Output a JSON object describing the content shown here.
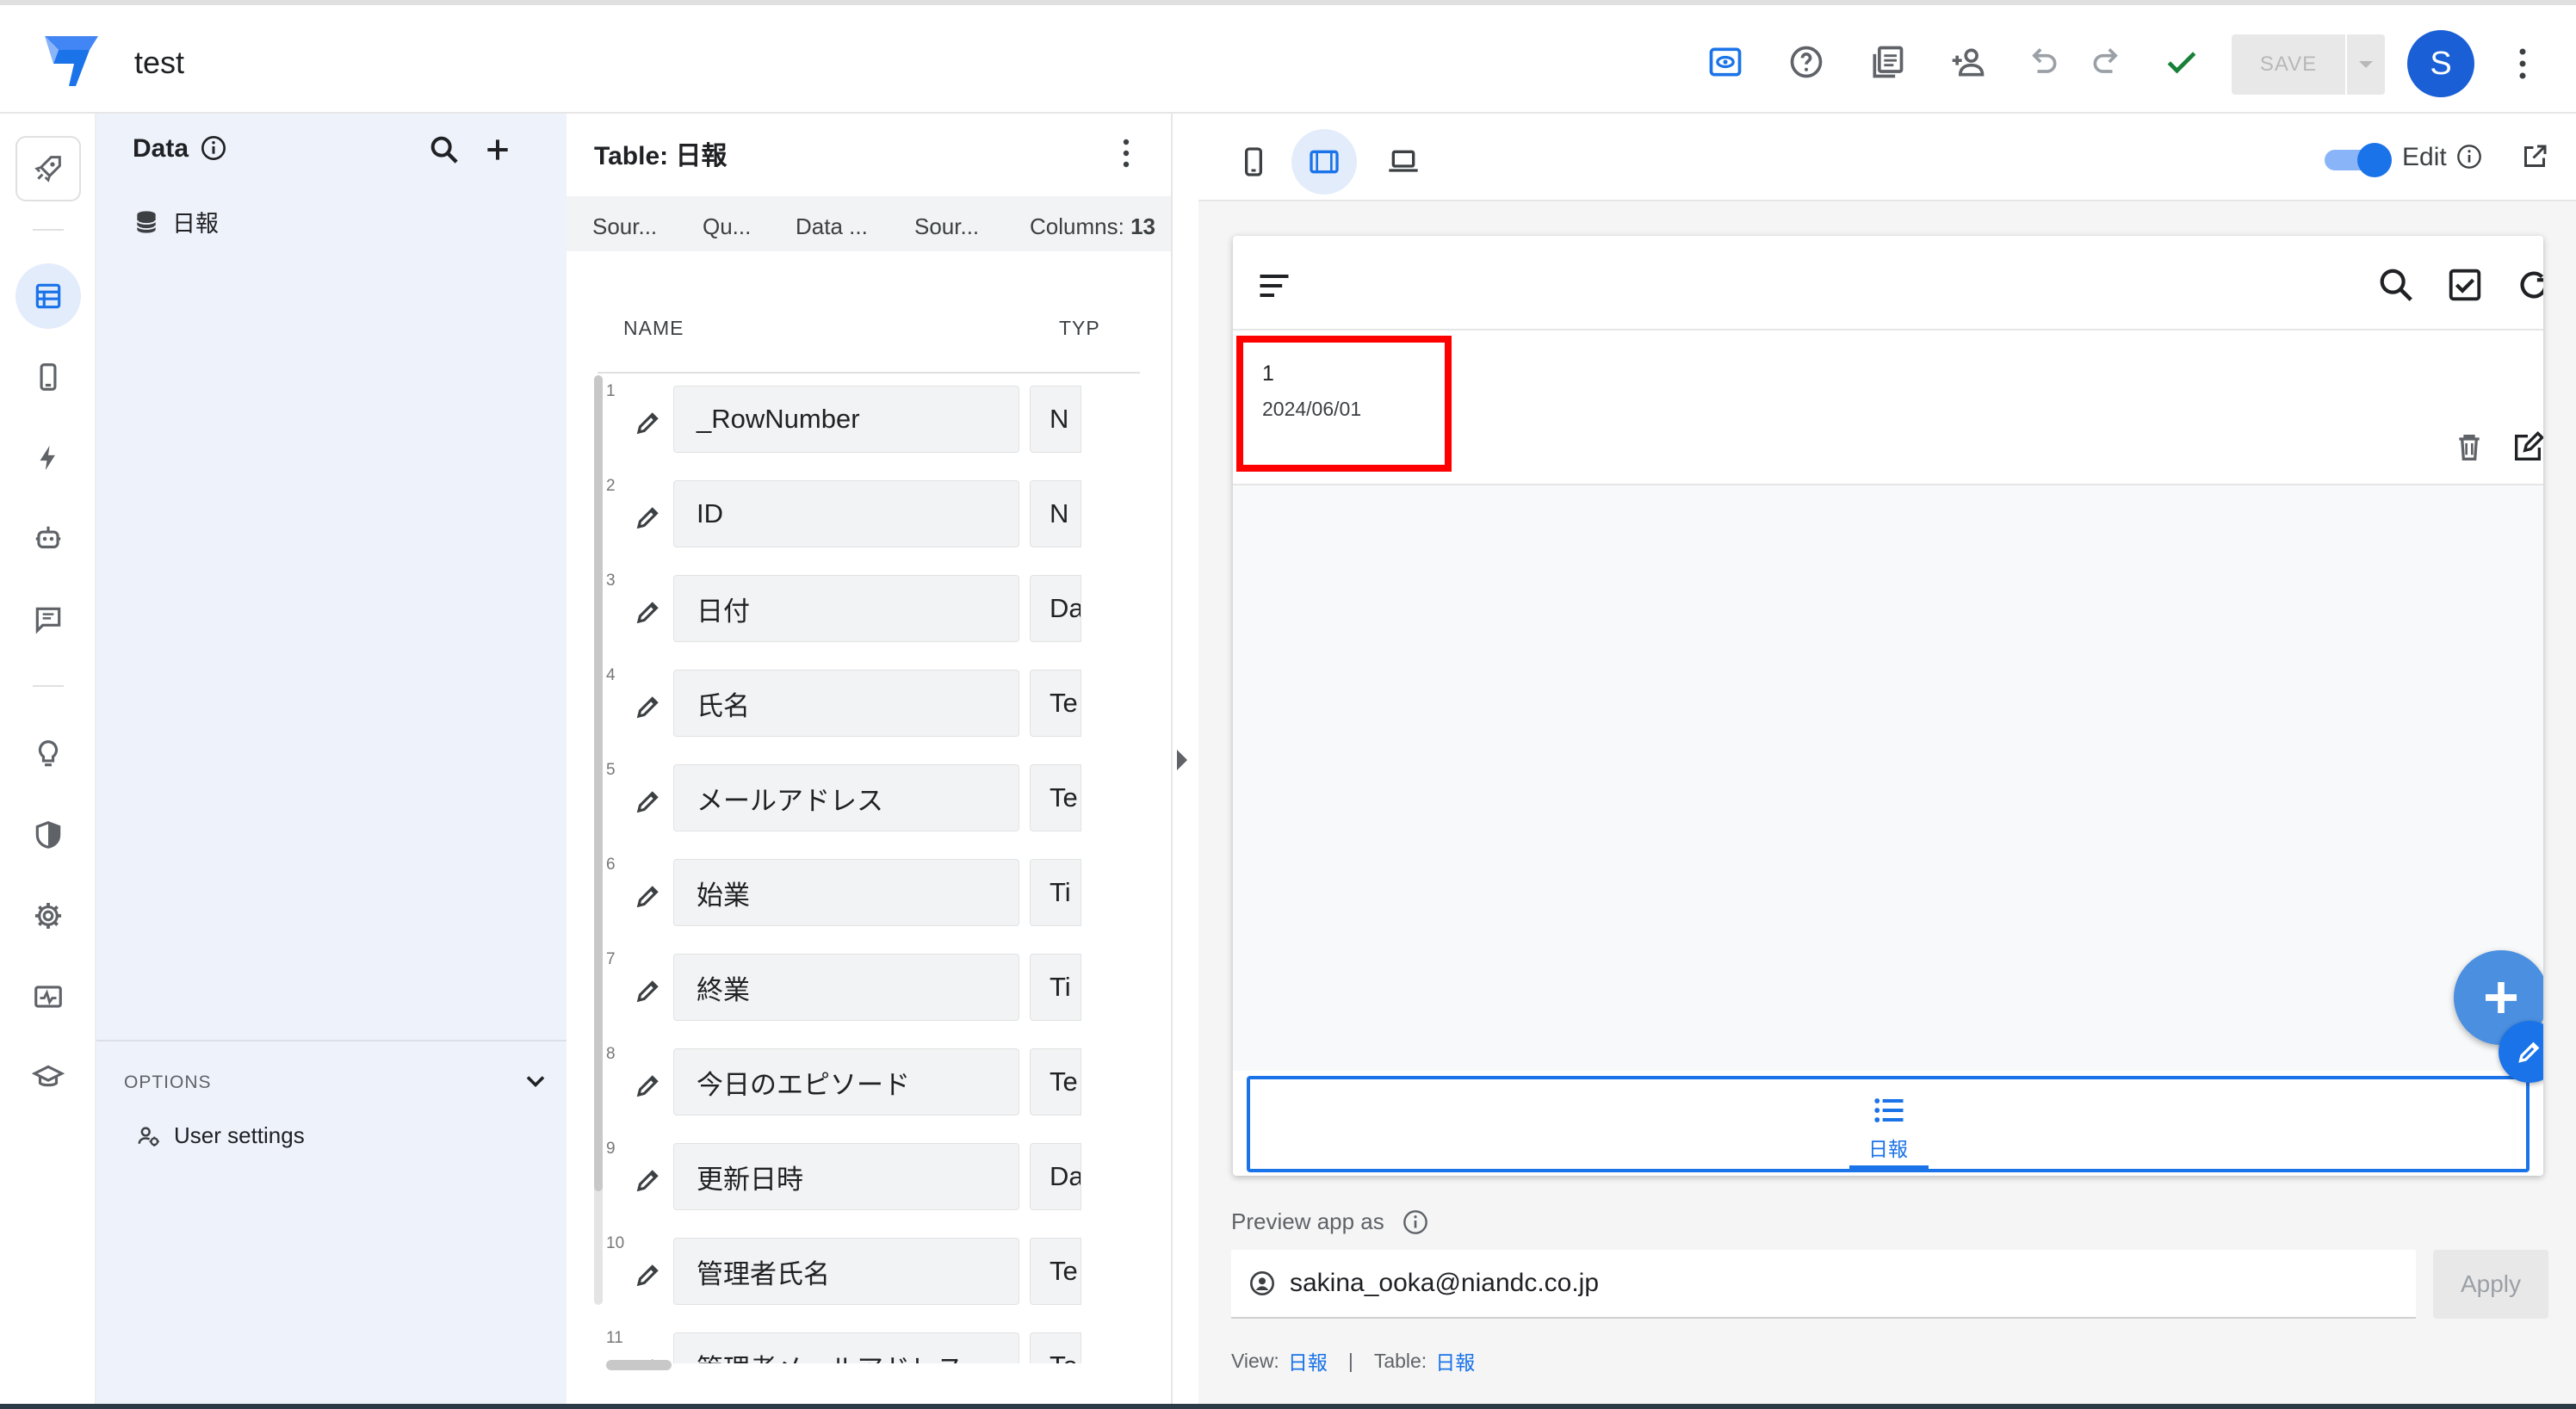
{
  "app": {
    "title": "test",
    "save_label": "SAVE",
    "avatar_initial": "S",
    "accent": "#1a73e8"
  },
  "topbar": {
    "icons": [
      "preview-icon",
      "help-icon",
      "docs-icon",
      "share-icon",
      "undo-icon",
      "redo-icon",
      "check-icon"
    ]
  },
  "left_nav": {
    "items": [
      "rocket-icon",
      "data-icon",
      "views-icon",
      "automation-icon",
      "bot-icon",
      "chat-icon",
      "ideas-icon",
      "security-icon",
      "settings-icon",
      "monitor-icon",
      "learn-icon"
    ],
    "active": "data-icon"
  },
  "data_panel": {
    "title": "Data",
    "tables": [
      {
        "label": "日報",
        "icon": "database-icon"
      }
    ],
    "options_label": "OPTIONS",
    "user_settings_label": "User settings"
  },
  "table_panel": {
    "title": "Table: 日報",
    "tabs": [
      "Sour...",
      "Qu...",
      "Data ...",
      "Sour...",
      "Columns:"
    ],
    "columns_count": "13",
    "col_name_header": "NAME",
    "col_type_header": "TYP",
    "rows": [
      {
        "num": "1",
        "name": "_RowNumber",
        "type": "N"
      },
      {
        "num": "2",
        "name": "ID",
        "type": "N"
      },
      {
        "num": "3",
        "name": "日付",
        "type": "Da"
      },
      {
        "num": "4",
        "name": "氏名",
        "type": "Te"
      },
      {
        "num": "5",
        "name": "メールアドレス",
        "type": "Te"
      },
      {
        "num": "6",
        "name": "始業",
        "type": "Ti"
      },
      {
        "num": "7",
        "name": "終業",
        "type": "Ti"
      },
      {
        "num": "8",
        "name": "今日のエピソード",
        "type": "Te"
      },
      {
        "num": "9",
        "name": "更新日時",
        "type": "Da"
      },
      {
        "num": "10",
        "name": "管理者氏名",
        "type": "Te"
      },
      {
        "num": "11",
        "name": "管理者メールアドレス",
        "type": "Te"
      }
    ]
  },
  "preview": {
    "edit_label": "Edit",
    "edit_on": true,
    "item": {
      "id": "1",
      "date": "2024/06/01"
    },
    "tab_label": "日報",
    "preview_as_label": "Preview app as",
    "preview_email": "sakina_ooka@niandc.co.jp",
    "apply_label": "Apply",
    "footer": {
      "view_label": "View:",
      "view_value": "日報",
      "sep": "|",
      "table_label": "Table:",
      "table_value": "日報"
    }
  }
}
